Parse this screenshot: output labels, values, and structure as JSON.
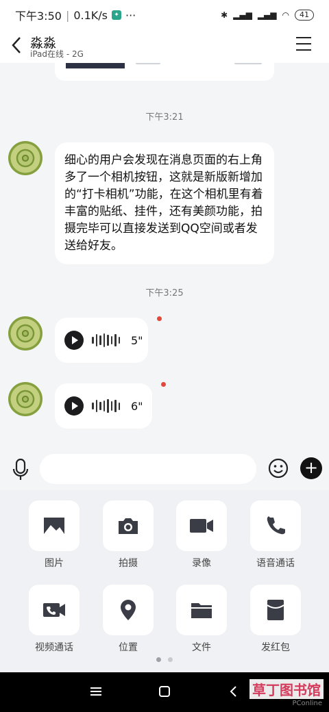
{
  "status_bar": {
    "time": "下午3:50",
    "net_speed": "0.1K/s",
    "dots": "···",
    "battery": "41"
  },
  "header": {
    "contact_name": "淼淼",
    "contact_status": "iPad在线 - 2G"
  },
  "messages": {
    "time1": "下午3:21",
    "text1": "细心的用户会发现在消息页面的右上角多了一个相机按钮，这就是新版新增加的“打卡相机”功能，在这个相机里有着丰富的贴纸、挂件，还有美颜功能，拍摄完毕可以直接发送到QQ空间或者发送给好友。",
    "time2": "下午3:25",
    "voice1_duration": "5\"",
    "voice2_duration": "6\""
  },
  "input": {
    "placeholder": ""
  },
  "panel": {
    "items": [
      {
        "label": "图片",
        "icon": "image-icon"
      },
      {
        "label": "拍摄",
        "icon": "camera-icon"
      },
      {
        "label": "录像",
        "icon": "video-icon"
      },
      {
        "label": "语音通话",
        "icon": "phone-icon"
      },
      {
        "label": "视频通话",
        "icon": "video-call-icon"
      },
      {
        "label": "位置",
        "icon": "location-icon"
      },
      {
        "label": "文件",
        "icon": "folder-icon"
      },
      {
        "label": "发红包",
        "icon": "red-packet-icon"
      }
    ]
  },
  "watermark": {
    "text": "草丁图书馆",
    "subtext": "PConline"
  }
}
